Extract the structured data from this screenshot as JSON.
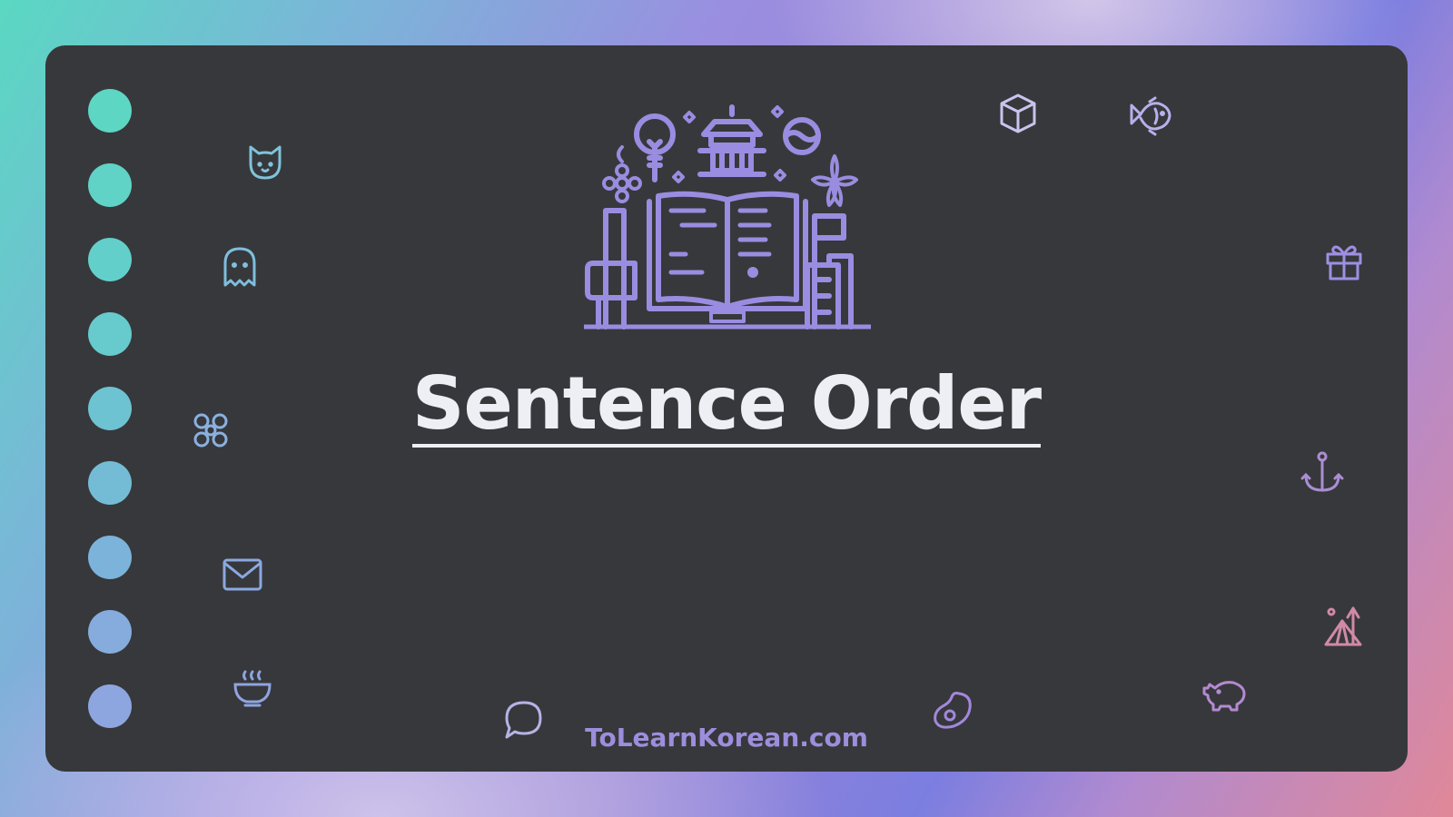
{
  "slide": {
    "title": "Sentence Order",
    "footer": "ToLearnKorean.com"
  },
  "colors": {
    "card_background": "#37383b",
    "title_text": "#eeeef5",
    "footer_text": "#9d8edc",
    "hero_illustration": "#9a8ce0",
    "dot_gradient_top": "#5dd6c3",
    "dot_gradient_bottom": "#8ea6e0"
  },
  "decorations": {
    "hero": "book-pagoda-illustration",
    "dot_count": 9,
    "icons": [
      "cat-icon",
      "ghost-icon",
      "flower-icon",
      "mail-icon",
      "soup-bowl-icon",
      "chat-bubble-icon",
      "cube-icon",
      "fish-icon",
      "gift-icon",
      "anchor-icon",
      "camping-icon",
      "piggy-bank-icon",
      "steak-icon"
    ]
  }
}
